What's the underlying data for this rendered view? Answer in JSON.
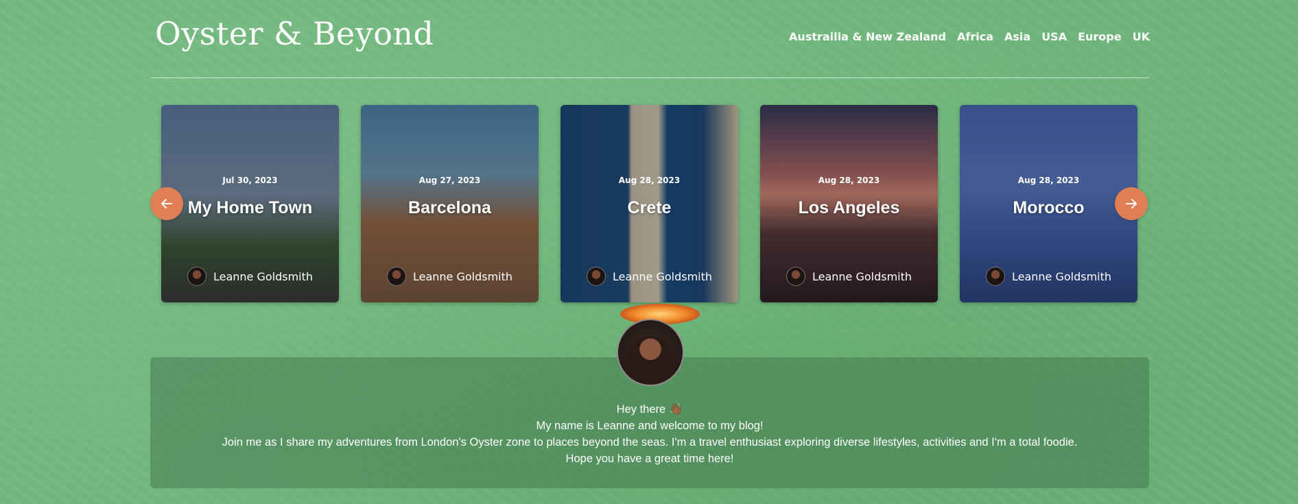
{
  "site": {
    "logo": "Oyster & Beyond"
  },
  "nav": {
    "items": [
      {
        "label": "Austrailia & New Zealand"
      },
      {
        "label": "Africa"
      },
      {
        "label": "Asia"
      },
      {
        "label": "USA"
      },
      {
        "label": "Europe"
      },
      {
        "label": "UK"
      }
    ]
  },
  "carousel": {
    "prev_icon": "arrow-left-icon",
    "next_icon": "arrow-right-icon",
    "accent_color": "#e07f56",
    "cards": [
      {
        "date": "Jul 30, 2023",
        "title": "My Home Town",
        "author": "Leanne Goldsmith"
      },
      {
        "date": "Aug 27, 2023",
        "title": "Barcelona",
        "author": "Leanne Goldsmith"
      },
      {
        "date": "Aug 28, 2023",
        "title": "Crete",
        "author": "Leanne Goldsmith"
      },
      {
        "date": "Aug 28, 2023",
        "title": "Los Angeles",
        "author": "Leanne Goldsmith"
      },
      {
        "date": "Aug 28, 2023",
        "title": "Morocco",
        "author": "Leanne Goldsmith"
      }
    ]
  },
  "about": {
    "line1": "Hey there 👋🏾",
    "line2": "My name is Leanne and welcome to my blog!",
    "line3": "Join me as I share my adventures from London's Oyster zone to places beyond the seas. I'm a travel enthusiast exploring diverse lifestyles, activities and I'm a total foodie.",
    "line4": "Hope you have a great time here!"
  }
}
